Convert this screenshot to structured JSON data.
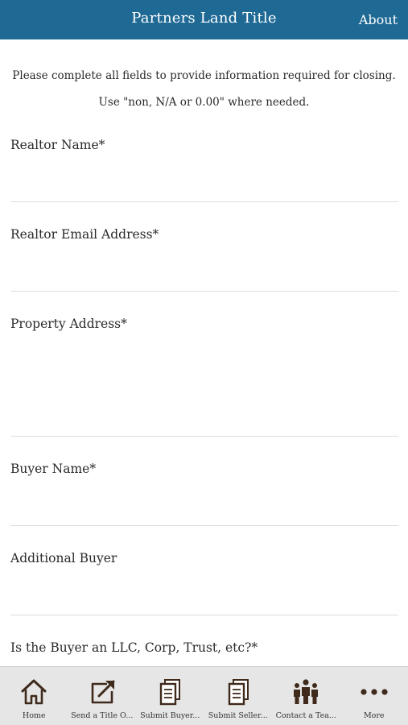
{
  "colors": {
    "accent": "#1f6a95",
    "icon": "#3f2a1c"
  },
  "header": {
    "title": "Partners Land Title",
    "about": "About"
  },
  "intro": {
    "line1": "Please complete all fields to provide information required for closing.",
    "line2": "Use \"non, N/A or 0.00\" where needed."
  },
  "form": {
    "fields": [
      {
        "label": "Realtor Name*",
        "value": ""
      },
      {
        "label": "Realtor Email Address*",
        "value": ""
      },
      {
        "label": "Property Address*",
        "value": ""
      },
      {
        "label": "Buyer Name*",
        "value": ""
      },
      {
        "label": "Additional Buyer",
        "value": ""
      },
      {
        "label": "Is the Buyer an LLC, Corp, Trust, etc?*",
        "value": ""
      }
    ]
  },
  "tabbar": {
    "tabs": [
      {
        "label": "Home",
        "icon": "home-icon"
      },
      {
        "label": "Send a Title O...",
        "icon": "send-icon"
      },
      {
        "label": "Submit Buyer...",
        "icon": "documents-icon"
      },
      {
        "label": "Submit Seller...",
        "icon": "documents-icon"
      },
      {
        "label": "Contact a Tea...",
        "icon": "team-icon"
      },
      {
        "label": "More",
        "icon": "more-icon"
      }
    ]
  }
}
